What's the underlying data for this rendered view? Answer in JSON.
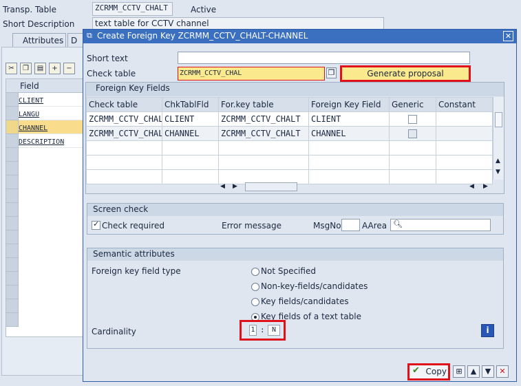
{
  "bg": {
    "transp_table_label": "Transp. Table",
    "transp_table_value": "ZCRMM_CCTV_CHALT",
    "status": "Active",
    "short_desc_label": "Short Description",
    "short_desc_value": "text table for CCTV channel",
    "tab_attributes": "Attributes",
    "tab_d": "D",
    "field_header": "Field",
    "fields": [
      "CLIENT",
      "LANGU",
      "CHANNEL",
      "DESCRIPTION"
    ]
  },
  "dialog": {
    "title": "Create Foreign Key ZCRMM_CCTV_CHALT-CHANNEL",
    "short_text_label": "Short text",
    "short_text_value": "",
    "check_table_label": "Check table",
    "check_table_value": "ZCRMM_CCTV_CHAL",
    "generate_proposal": "Generate proposal",
    "fk_section_title": "Foreign Key Fields",
    "fk_columns": [
      "Check table",
      "ChkTablFld",
      "For.key table",
      "Foreign Key Field",
      "Generic",
      "Constant"
    ],
    "fk_rows": [
      [
        "ZCRMM_CCTV_CHAL",
        "CLIENT",
        "ZCRMM_CCTV_CHALT",
        "CLIENT"
      ],
      [
        "ZCRMM_CCTV_CHAL",
        "CHANNEL",
        "ZCRMM_CCTV_CHALT",
        "CHANNEL"
      ]
    ],
    "screen_check_title": "Screen check",
    "check_required_label": "Check required",
    "error_message_label": "Error message",
    "msgno_label": "MsgNo",
    "aarea_label": "AArea",
    "semantic_title": "Semantic attributes",
    "fk_field_type_label": "Foreign key field type",
    "radio_options": [
      "Not Specified",
      "Non-key-fields/candidates",
      "Key fields/candidates",
      "Key fields of a text table"
    ],
    "selected_radio": 3,
    "cardinality_label": "Cardinality",
    "card_left": "1",
    "card_sep": ":",
    "card_right": "N",
    "copy_label": "Copy",
    "highlight_color": "#e0101a",
    "title_color": "#3b6fbf"
  }
}
